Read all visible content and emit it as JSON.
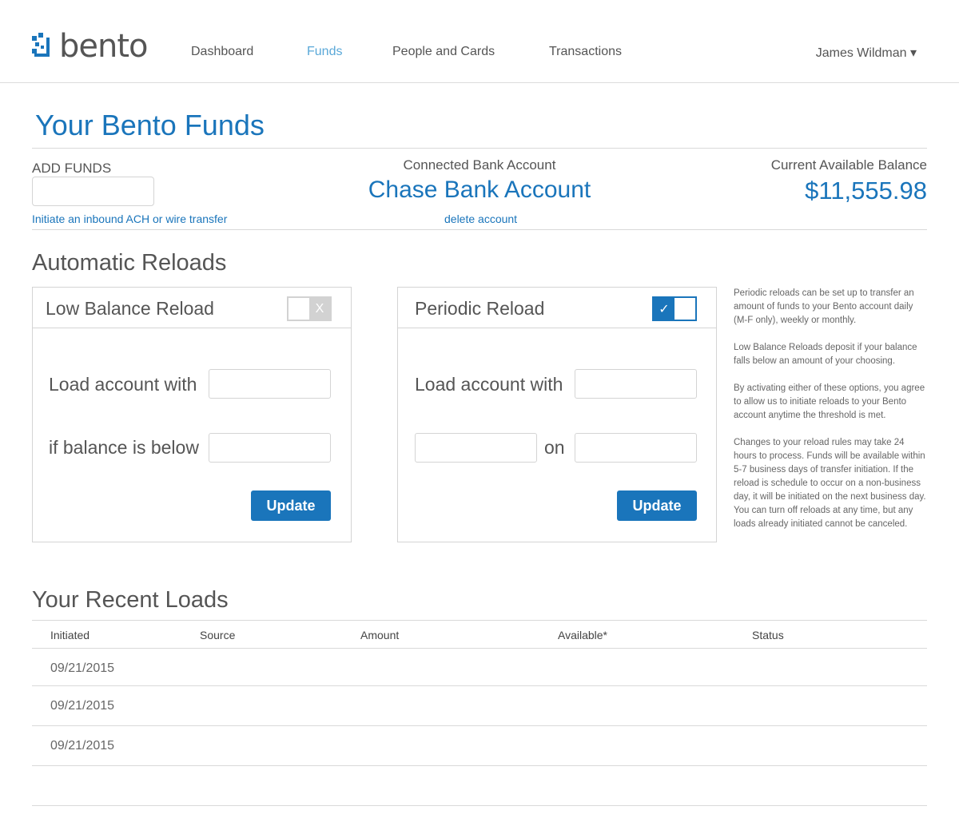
{
  "header": {
    "logo_text": "bento",
    "nav": [
      "Dashboard",
      "Funds",
      "People and Cards",
      "Transactions"
    ],
    "active_nav": "Funds",
    "user_name": "James Wildman ▾"
  },
  "funds": {
    "title": "Your Bento Funds",
    "add_label": "ADD FUNDS",
    "add_value": "",
    "ach_link": "Initiate an inbound ACH or wire transfer",
    "bank_label": "Connected Bank Account",
    "bank_name": "Chase Bank Account",
    "delete_link": "delete account",
    "balance_label": "Current Available Balance",
    "balance_value": "$11,555.98"
  },
  "reloads": {
    "title": "Automatic Reloads",
    "low_balance": {
      "title": "Low Balance Reload",
      "enabled": false,
      "toggle_glyph": "X",
      "load_label": "Load account with",
      "below_label": "if balance is below",
      "button": "Update"
    },
    "periodic": {
      "title": "Periodic Reload",
      "enabled": true,
      "toggle_glyph": "✓",
      "load_label": "Load account with",
      "on_label": "on",
      "button": "Update"
    },
    "info": [
      "Periodic reloads can be set up to transfer an amount of funds to your Bento account daily (M-F only), weekly or monthly.",
      "Low Balance Reloads deposit if your balance falls below an amount of your choosing.",
      "By activating either of these options, you agree to allow us to initiate reloads to your Bento account anytime the threshold is met.",
      "Changes to your reload rules may take 24 hours to process. Funds will be available within 5-7 business days of transfer initiation. If the reload is schedule to occur on a non-business day, it will be initiated on the next business day. You can turn off reloads at any time, but any loads already initiated cannot be canceled."
    ]
  },
  "loads": {
    "title": "Your Recent Loads",
    "columns": [
      "Initiated",
      "Source",
      "Amount",
      "Available*",
      "Status"
    ],
    "rows": [
      [
        "09/21/2015",
        "",
        "",
        "",
        ""
      ],
      [
        "09/21/2015",
        "",
        "",
        "",
        ""
      ],
      [
        "09/21/2015",
        "",
        "",
        "",
        ""
      ]
    ]
  },
  "colors": {
    "accent": "#1a75bb",
    "nav_active": "#5aa8d8",
    "text": "#555555",
    "border": "#d4d4d4"
  }
}
